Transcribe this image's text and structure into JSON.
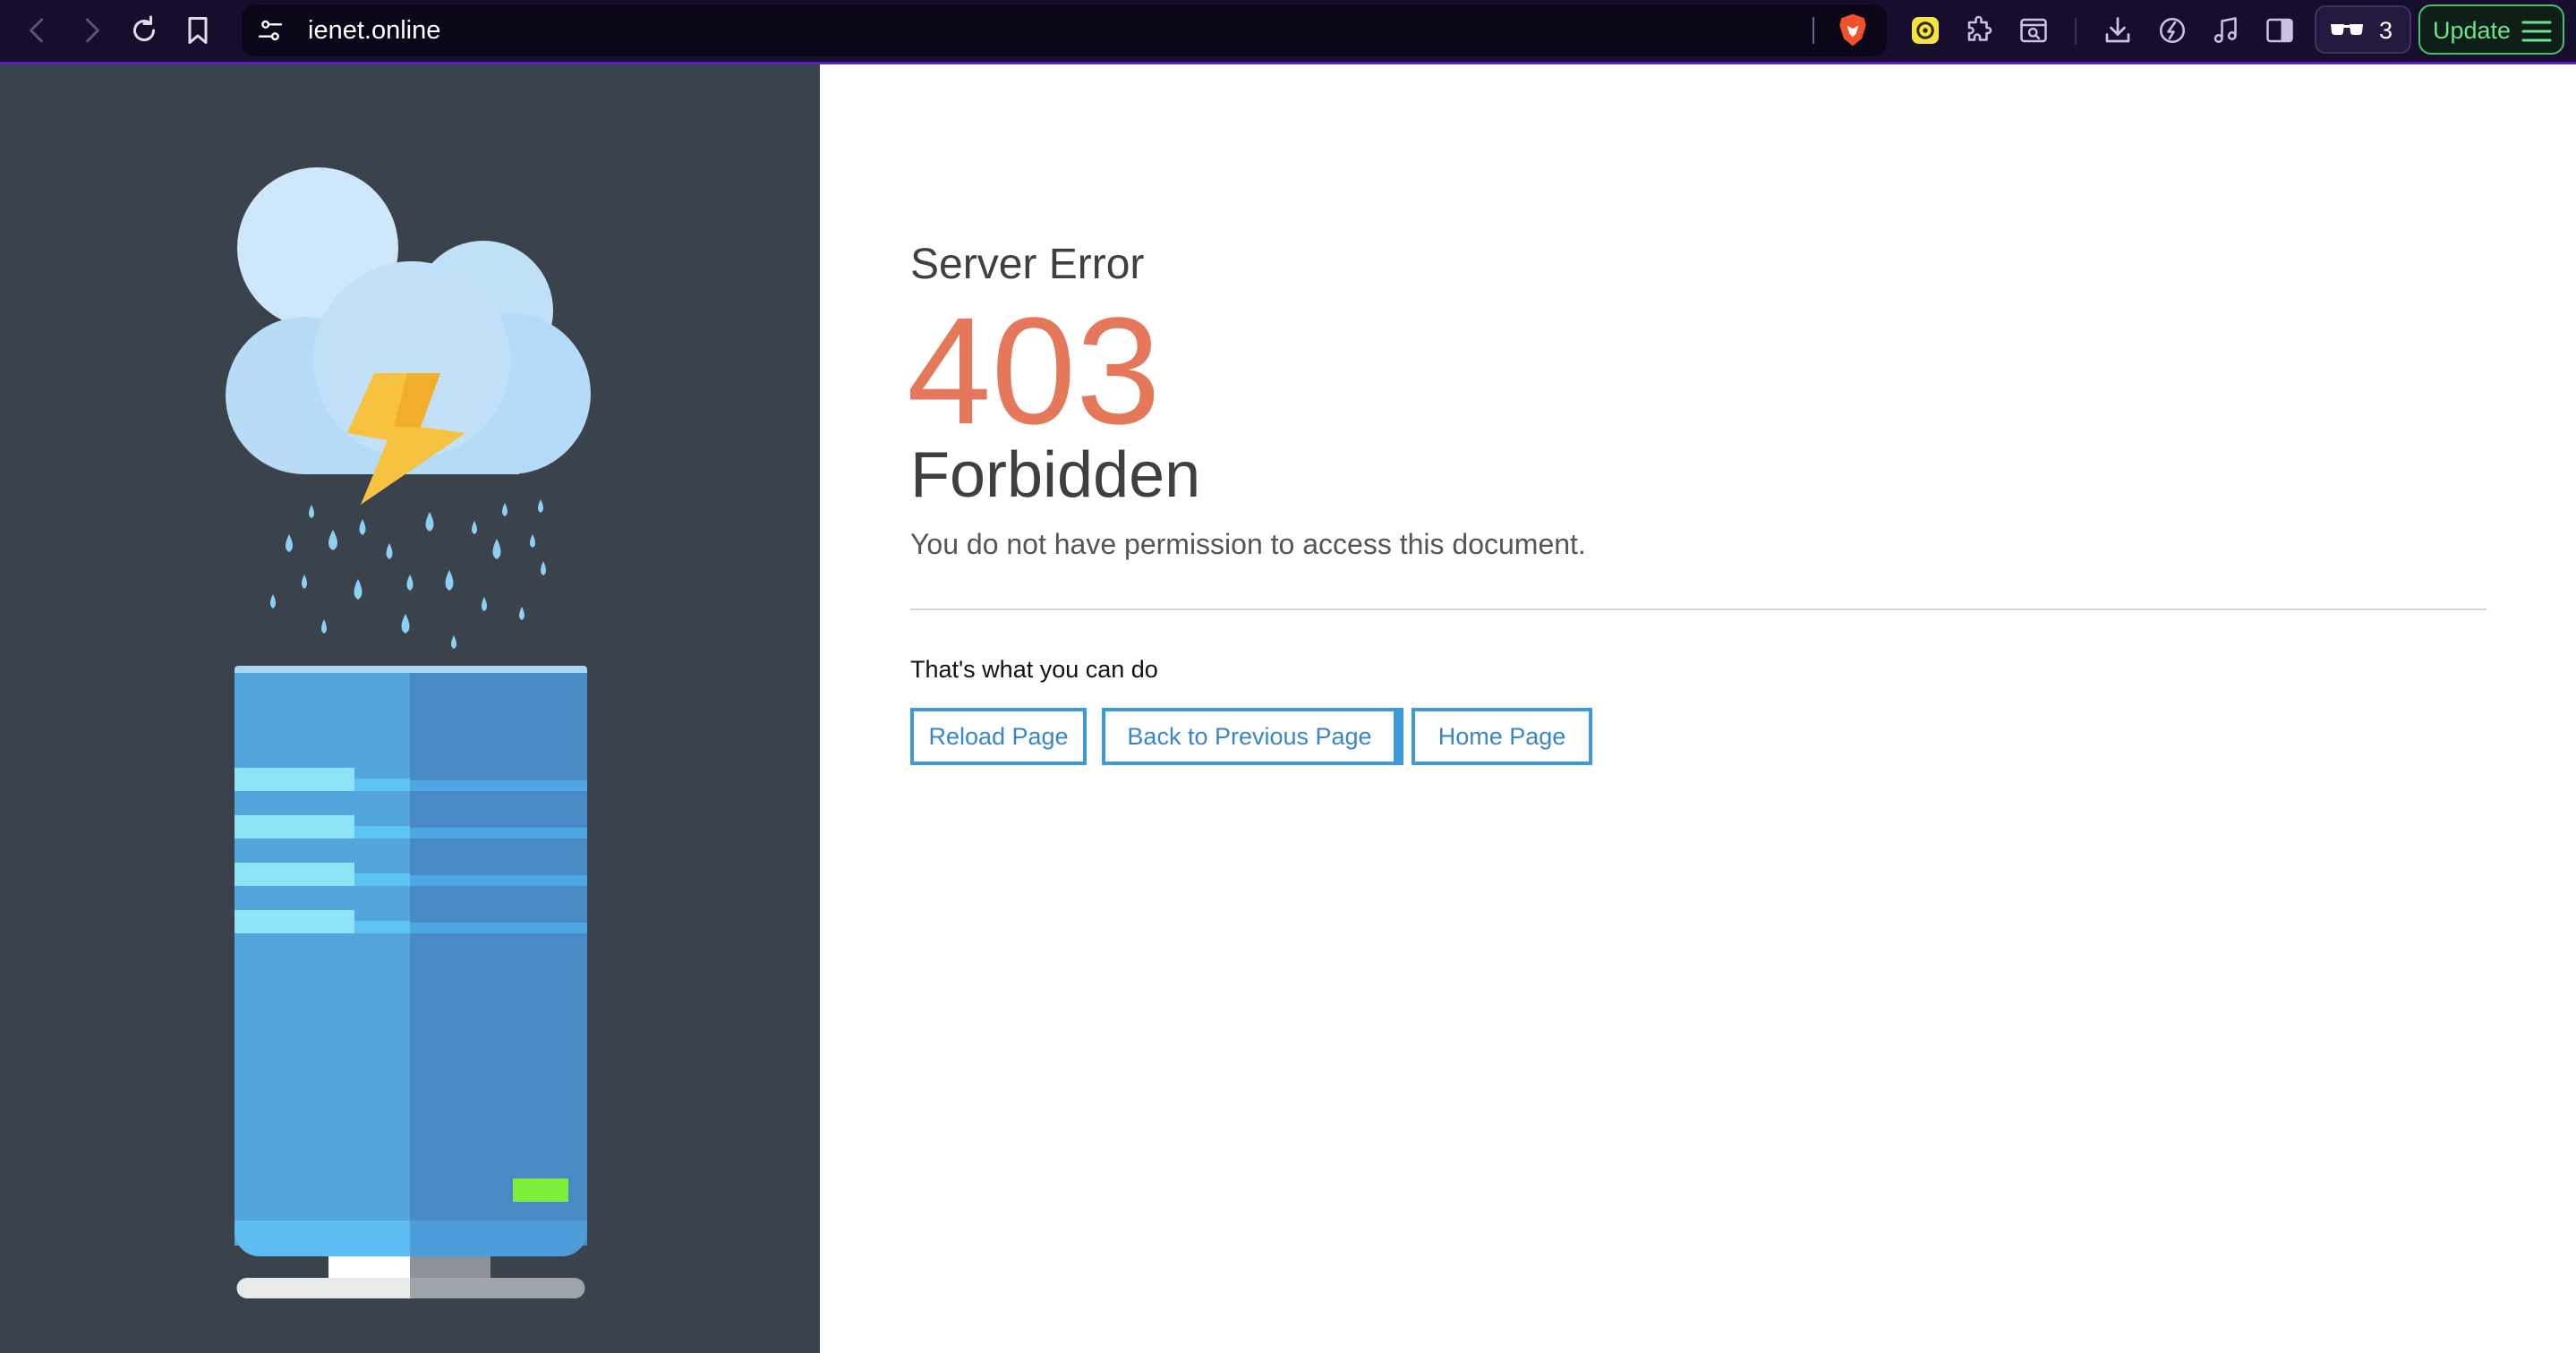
{
  "browser": {
    "url": "ienet.online",
    "sidebar_count": "3",
    "update_label": "Update",
    "icons": {
      "nav": [
        "back-icon",
        "forward-icon",
        "reload-icon",
        "bookmark-icon"
      ],
      "url_bar": [
        "site-info-icon",
        "brave-shield-icon"
      ],
      "extensions": [
        "wallet-extension-icon",
        "puzzle-extension-icon",
        "search-page-icon"
      ],
      "tools": [
        "download-icon",
        "leo-ai-icon",
        "media-music-icon",
        "sidebar-toggle-icon",
        "glasses-icon",
        "menu-icon"
      ]
    }
  },
  "page": {
    "subtitle": "Server Error",
    "code": "403",
    "title": "Forbidden",
    "message": "You do not have permission to access this document.",
    "actions_label": "That's what you can do",
    "actions": [
      "Reload Page",
      "Back to Previous Page",
      "Home Page"
    ]
  },
  "colors": {
    "toolbar_bg": "#170e2e",
    "accent_purple": "#5a1fc8",
    "panel_bg": "#3a424c",
    "error_code": "#e5775a",
    "button_border": "#3d9ad9",
    "update_green": "#47c26b"
  }
}
